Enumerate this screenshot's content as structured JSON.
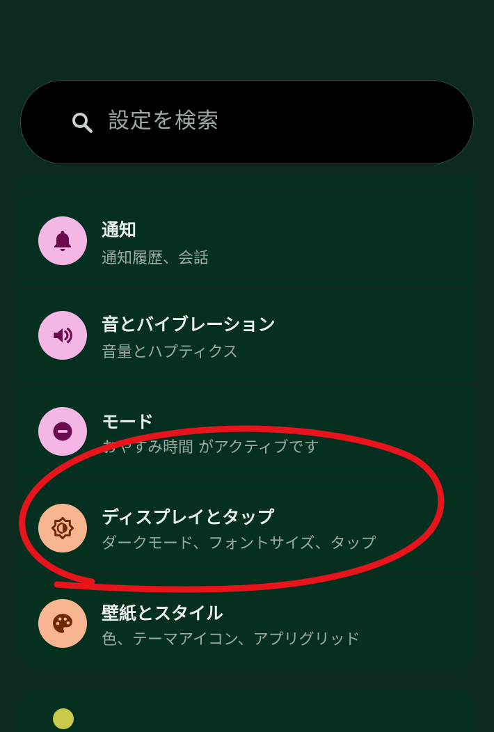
{
  "search": {
    "placeholder": "設定を検索",
    "icon": "search-icon"
  },
  "settings": {
    "items": [
      {
        "title": "通知",
        "subtitle": "通知履歴、会話",
        "icon": "bell-icon",
        "icon_bg": "#f4b6e4",
        "icon_fg": "#6b0a4f"
      },
      {
        "title": "音とバイブレーション",
        "subtitle": "音量とハプティクス",
        "icon": "speaker-icon",
        "icon_bg": "#f4b6e4",
        "icon_fg": "#6b0a4f"
      },
      {
        "title": "モード",
        "subtitle": "おやすみ時間 がアクティブです",
        "icon": "do-not-disturb-icon",
        "icon_bg": "#f4b6e4",
        "icon_fg": "#6b0a4f"
      },
      {
        "title": "ディスプレイとタップ",
        "subtitle": "ダークモード、フォントサイズ、タップ",
        "icon": "brightness-icon",
        "icon_bg": "#f7b690",
        "icon_fg": "#6a2b06"
      },
      {
        "title": "壁紙とスタイル",
        "subtitle": "色、テーマアイコン、アプリグリッド",
        "icon": "palette-icon",
        "icon_bg": "#f7b690",
        "icon_fg": "#6a2b06"
      }
    ]
  },
  "colors": {
    "background": "#0c2b1e",
    "card": "#05301f",
    "annotation": "#e8141c"
  }
}
